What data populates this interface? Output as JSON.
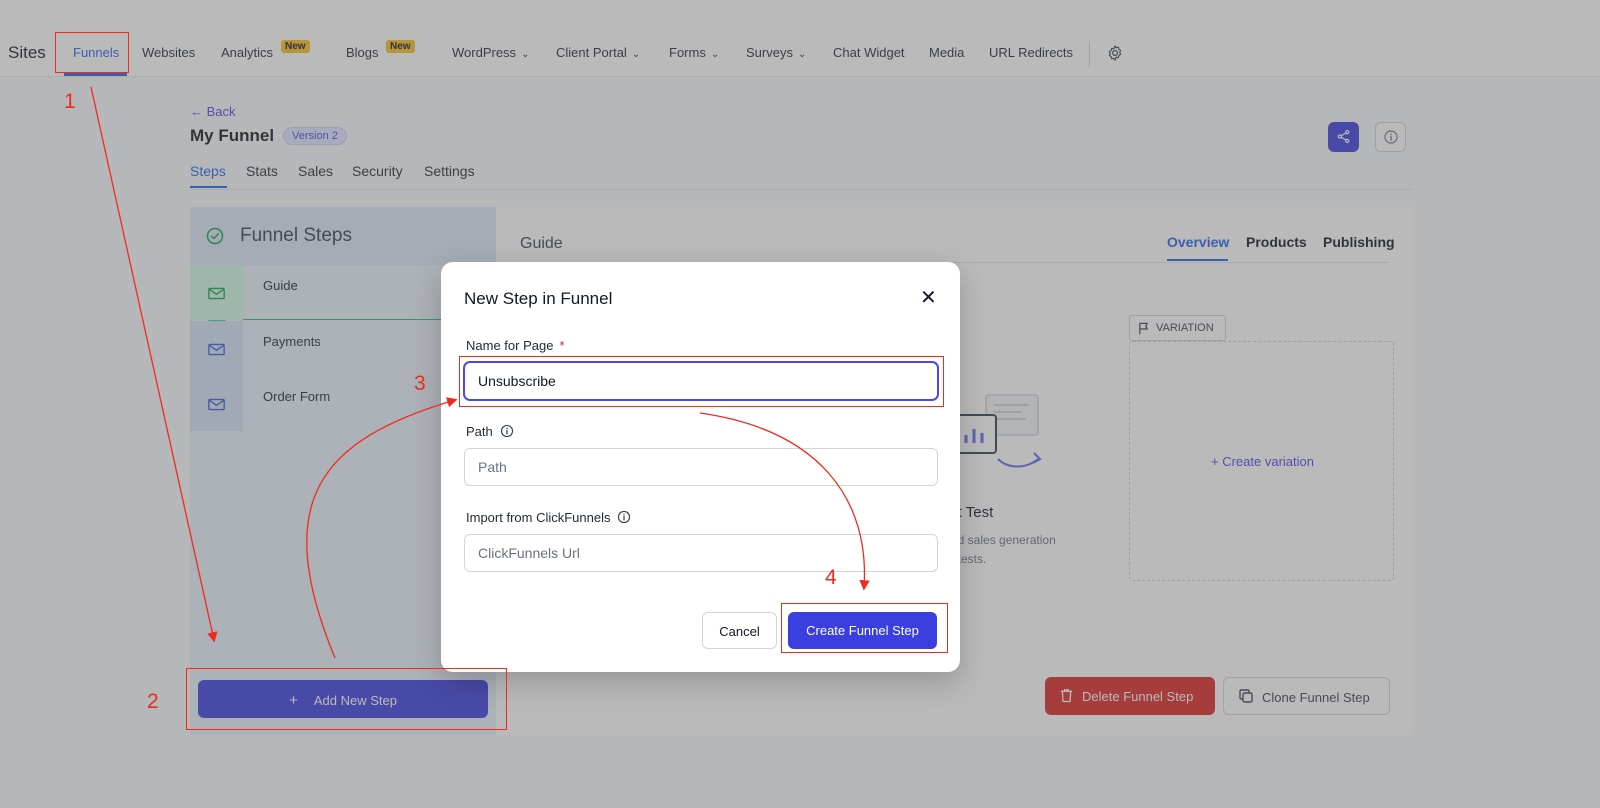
{
  "topnav": {
    "brand": "Sites",
    "items": [
      {
        "label": "Funnels"
      },
      {
        "label": "Websites"
      },
      {
        "label": "Analytics",
        "badge": "New"
      },
      {
        "label": "Blogs",
        "badge": "New"
      },
      {
        "label": "WordPress",
        "dropdown": true
      },
      {
        "label": "Client Portal",
        "dropdown": true
      },
      {
        "label": "Forms",
        "dropdown": true
      },
      {
        "label": "Surveys",
        "dropdown": true
      },
      {
        "label": "Chat Widget"
      },
      {
        "label": "Media"
      },
      {
        "label": "URL Redirects"
      }
    ],
    "active": "Funnels",
    "settings_icon": "gear-icon"
  },
  "funnel": {
    "back_label": "← Back",
    "title": "My Funnel",
    "version": "Version 2",
    "tabs": [
      "Steps",
      "Stats",
      "Sales",
      "Security",
      "Settings"
    ],
    "active_tab": "Steps"
  },
  "steps_panel": {
    "title": "Funnel Steps",
    "steps": [
      {
        "label": "Guide",
        "active": true
      },
      {
        "label": "Payments"
      },
      {
        "label": "Order Form"
      }
    ],
    "add_button": "Add New Step"
  },
  "detail_panel": {
    "heading": "Guide",
    "tabs": [
      "Overview",
      "Products",
      "Publishing"
    ],
    "active_tab": "Overview",
    "variation_tag": "VARIATION",
    "create_variation": "Create variation",
    "split_title": "lit Test",
    "split_desc_1": "nd sales generation",
    "split_desc_2": "t tests.",
    "delete_button": "Delete Funnel Step",
    "clone_button": "Clone Funnel Step"
  },
  "modal": {
    "title": "New Step in Funnel",
    "close_icon": "close-icon",
    "name_label": "Name for Page",
    "required_mark": "*",
    "name_value": "Unsubscribe",
    "path_label": "Path",
    "path_placeholder": "Path",
    "import_label": "Import from ClickFunnels",
    "import_placeholder": "ClickFunnels Url",
    "cancel_button": "Cancel",
    "create_button": "Create Funnel Step"
  },
  "annotations": {
    "color": "#ef2b1e",
    "numbers": [
      "1",
      "2",
      "3",
      "4"
    ]
  },
  "colors": {
    "accent": "#3b3fe0",
    "link": "#2563eb",
    "danger": "#dc2626",
    "badge": "#fbbf24"
  }
}
